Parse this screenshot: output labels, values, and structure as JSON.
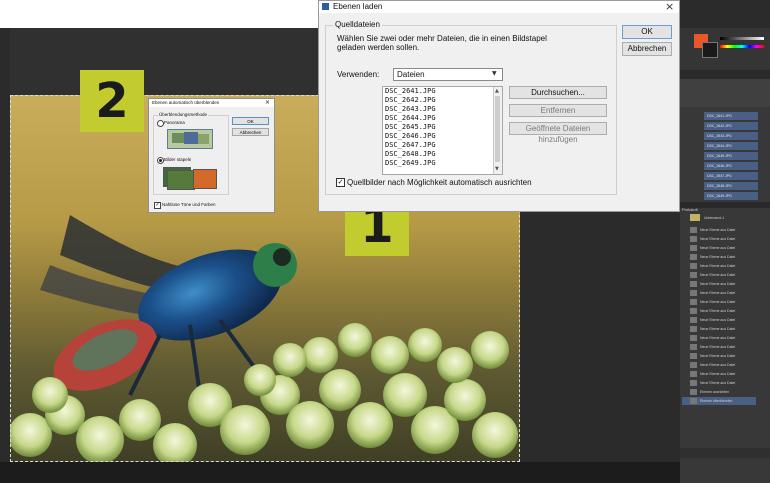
{
  "load_dialog": {
    "title": "Ebenen laden",
    "close_glyph": "×",
    "group_label": "Quelldateien",
    "instruction_line1": "Wählen Sie zwei oder mehr Dateien, die in einen Bildstapel",
    "instruction_line2": "geladen werden sollen.",
    "use_label": "Verwenden:",
    "use_value": "Dateien",
    "files": [
      "DSC_2641.JPG",
      "DSC_2642.JPG",
      "DSC_2643.JPG",
      "DSC_2644.JPG",
      "DSC_2645.JPG",
      "DSC_2646.JPG",
      "DSC_2647.JPG",
      "DSC_2648.JPG",
      "DSC_2649.JPG"
    ],
    "browse_label": "Durchsuchen...",
    "remove_label": "Entfernen",
    "add_open_label": "Geöffnete Dateien hinzufügen",
    "ok_label": "OK",
    "cancel_label": "Abbrechen",
    "auto_align_label": "Quellbilder nach Möglichkeit automatisch ausrichten",
    "auto_align_checked": true
  },
  "blend_dialog": {
    "title": "Ebenen automatisch überblenden",
    "close_glyph": "×",
    "group_label": "Überblendungsmethode",
    "option_panorama": "Panorama",
    "option_stack": "Bilder stapeln",
    "selected": "Bilder stapeln",
    "ok_label": "OK",
    "cancel_label": "Abbrechen",
    "seamless_label": "Nahtlose Töne und Farben",
    "seamless_checked": true
  },
  "badges": {
    "one": "1",
    "two": "2"
  },
  "layers_panel": {
    "layers": [
      "DSC_2641.JPG",
      "DSC_2642.JPG",
      "DSC_2643.JPG",
      "DSC_2644.JPG",
      "DSC_2645.JPG",
      "DSC_2646.JPG",
      "DSC_2647.JPG",
      "DSC_2648.JPG",
      "DSC_2649.JPG"
    ]
  },
  "history_panel": {
    "header": "Protokoll",
    "snapshot": "Unbenannt-1",
    "steps": [
      "Neue Ebene aus Datei",
      "Neue Ebene aus Datei",
      "Neue Ebene aus Datei",
      "Neue Ebene aus Datei",
      "Neue Ebene aus Datei",
      "Neue Ebene aus Datei",
      "Neue Ebene aus Datei",
      "Neue Ebene aus Datei",
      "Neue Ebene aus Datei",
      "Neue Ebene aus Datei",
      "Neue Ebene aus Datei",
      "Neue Ebene aus Datei",
      "Neue Ebene aus Datei",
      "Neue Ebene aus Datei",
      "Neue Ebene aus Datei",
      "Neue Ebene aus Datei",
      "Neue Ebene aus Datei",
      "Neue Ebene aus Datei",
      "Ebenen ausrichten",
      "Ebenen überblenden"
    ]
  },
  "colors": {
    "badge": "#c3cc2e",
    "layer_selected": "#4a5f86",
    "dialog_bg": "#f0f0f0"
  }
}
